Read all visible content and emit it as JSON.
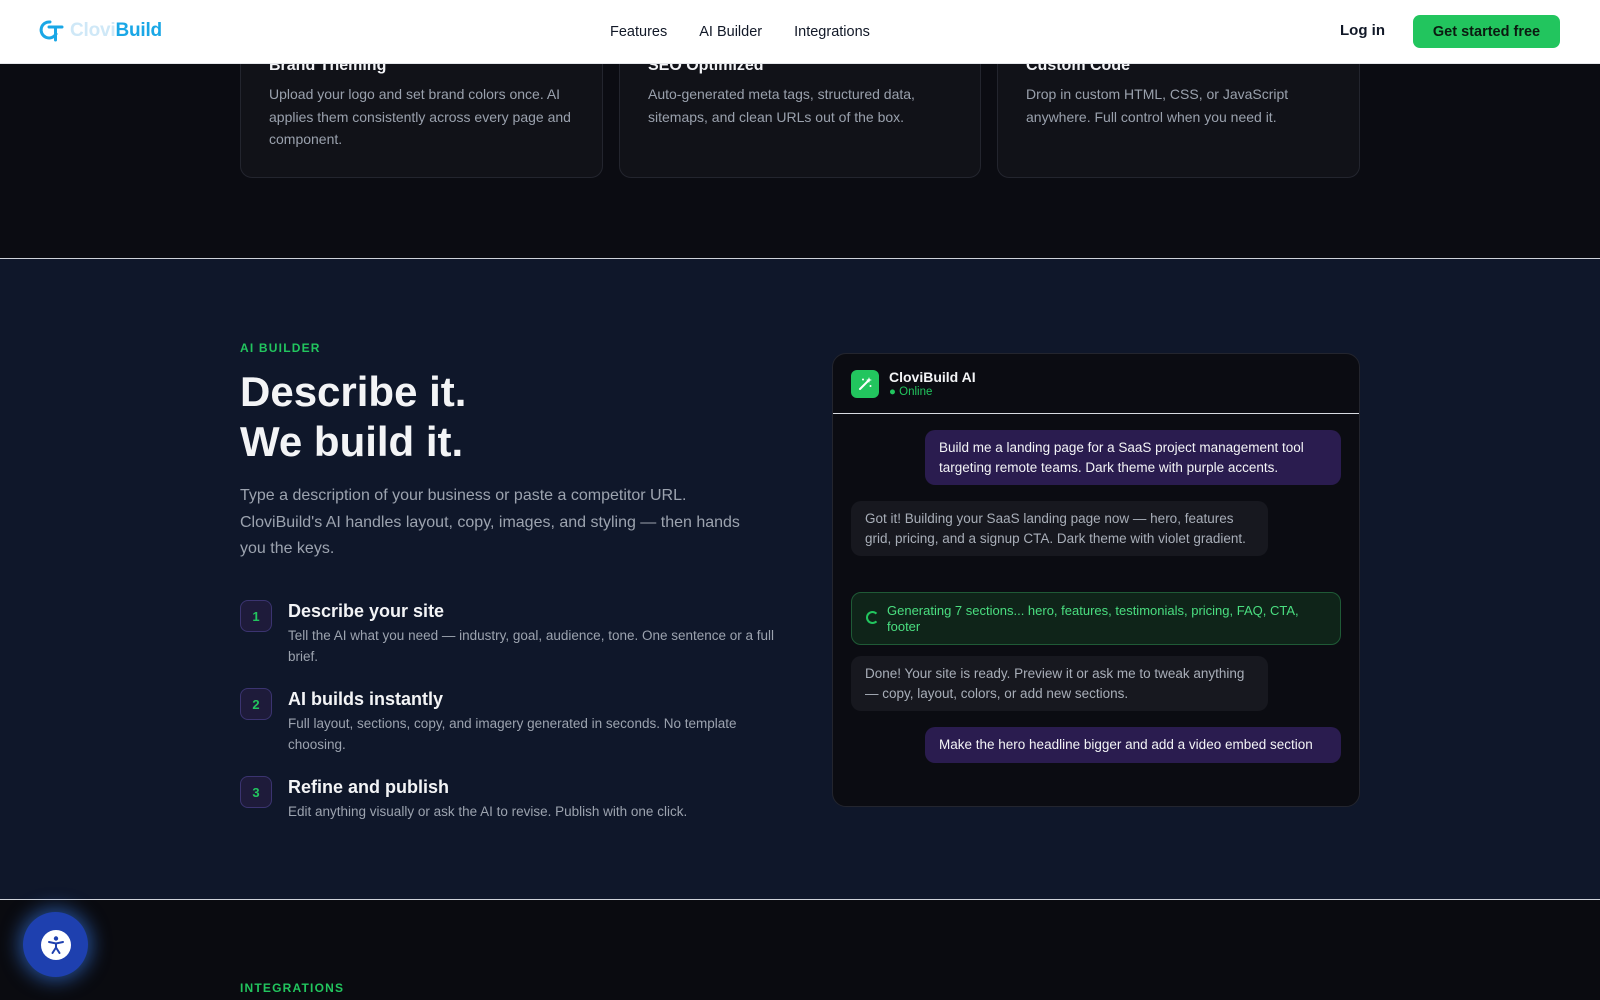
{
  "nav": {
    "logo_part1": "Clovi",
    "logo_part2": "Build",
    "links": [
      "Features",
      "AI Builder",
      "Integrations"
    ],
    "login": "Log in",
    "cta": "Get started free"
  },
  "features": [
    {
      "title": "Brand Theming",
      "desc": "Upload your logo and set brand colors once. AI applies them consistently across every page and component."
    },
    {
      "title": "SEO Optimized",
      "desc": "Auto-generated meta tags, structured data, sitemaps, and clean URLs out of the box."
    },
    {
      "title": "Custom Code",
      "desc": "Drop in custom HTML, CSS, or JavaScript anywhere. Full control when you need it."
    }
  ],
  "builder": {
    "eyebrow": "AI BUILDER",
    "headline_line1": "Describe it.",
    "headline_line2": "We build it.",
    "lead": "Type a description of your business or paste a competitor URL. CloviBuild's AI handles layout, copy, images, and styling — then hands you the keys.",
    "steps": [
      {
        "num": "1",
        "title": "Describe your site",
        "desc": "Tell the AI what you need — industry, goal, audience, tone. One sentence or a full brief."
      },
      {
        "num": "2",
        "title": "AI builds instantly",
        "desc": "Full layout, sections, copy, and imagery generated in seconds. No template choosing."
      },
      {
        "num": "3",
        "title": "Refine and publish",
        "desc": "Edit anything visually or ask the AI to revise. Publish with one click."
      }
    ]
  },
  "chat": {
    "name": "CloviBuild AI",
    "status": "● Online",
    "messages": [
      "Build me a landing page for a SaaS project management tool targeting remote teams. Dark theme with purple accents.",
      "Got it! Building your SaaS landing page now — hero, features grid, pricing, and a signup CTA. Dark theme with violet gradient.",
      "Generating 7 sections... hero, features, testimonials, pricing, FAQ, CTA, footer",
      "Done! Your site is ready. Preview it or ask me to tweak anything — copy, layout, colors, or add new sections.",
      "Make the hero headline bigger and add a video embed section"
    ]
  },
  "integrations": {
    "eyebrow": "INTEGRATIONS"
  },
  "colors": {
    "accent_green": "#22c55e",
    "brand_blue": "#1aa7e6",
    "user_bubble": "#2a1c4f"
  },
  "icons": {
    "logo": "clovibuild-logo-icon",
    "chat_avatar": "magic-wand-icon",
    "a11y": "accessibility-icon"
  }
}
